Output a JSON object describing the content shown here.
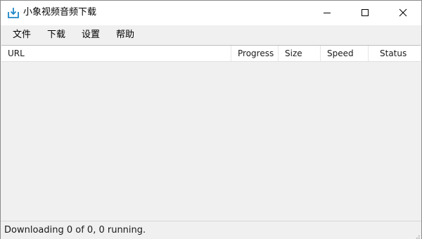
{
  "window": {
    "title": "小象视频音频下载",
    "app_icon": "download-tray-icon",
    "controls": {
      "minimize_icon": "minimize-icon",
      "maximize_icon": "maximize-icon",
      "close_icon": "close-icon"
    }
  },
  "menu": {
    "items": [
      {
        "label": "文件"
      },
      {
        "label": "下载"
      },
      {
        "label": "设置"
      },
      {
        "label": "帮助"
      }
    ]
  },
  "list": {
    "columns": [
      {
        "label": "URL"
      },
      {
        "label": "Progress"
      },
      {
        "label": "Size"
      },
      {
        "label": "Speed"
      },
      {
        "label": "Status"
      }
    ],
    "rows": []
  },
  "status": {
    "text": "Downloading 0 of 0, 0 running."
  },
  "colors": {
    "background": "#f0f0f0",
    "titlebar": "#ffffff",
    "icon_accent": "#1e88c8"
  }
}
